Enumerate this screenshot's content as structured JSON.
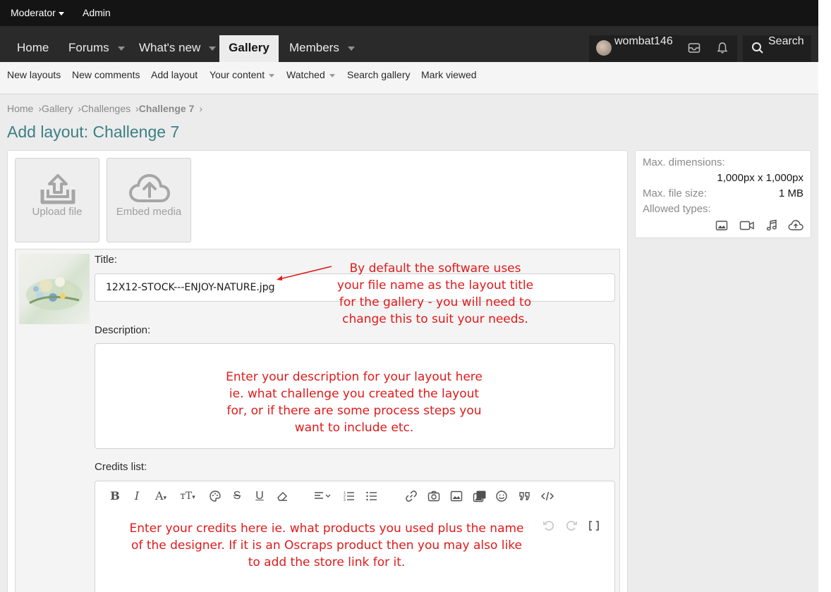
{
  "staffbar": {
    "moderator": "Moderator",
    "admin": "Admin"
  },
  "nav": {
    "tabs": [
      {
        "label": "Home"
      },
      {
        "label": "Forums"
      },
      {
        "label": "What's new"
      },
      {
        "label": "Gallery"
      },
      {
        "label": "Members"
      }
    ],
    "user": "wombat146",
    "search": "Search"
  },
  "subnav": {
    "items": [
      "New layouts",
      "New comments",
      "Add layout",
      "Your content",
      "Watched",
      "Search gallery",
      "Mark viewed"
    ]
  },
  "breadcrumb": [
    "Home",
    "Gallery",
    "Challenges",
    "Challenge 7"
  ],
  "page_title": "Add layout: Challenge 7",
  "upload": {
    "upload_file": "Upload file",
    "embed_media": "Embed media"
  },
  "form": {
    "title_label": "Title:",
    "title_value": "12X12-STOCK---ENJOY-NATURE.jpg",
    "description_label": "Description:",
    "credits_label": "Credits list:"
  },
  "annotations": {
    "title_note": [
      "By default the software uses",
      "your file name as the layout title",
      "for the gallery - you will need to",
      "change this to suit your needs."
    ],
    "description_note": [
      "Enter your description for your layout here",
      "ie. what challenge you created the layout",
      "for, or if there are some process steps you",
      "want to include etc."
    ],
    "credits_note": [
      "Enter your credits here ie. what products you used plus the name",
      "of the designer. If it is an Oscraps product then you may also like",
      "to add the store link for it."
    ]
  },
  "sidebar": {
    "max_dimensions_label": "Max. dimensions:",
    "max_dimensions_value": "1,000px x 1,000px",
    "max_file_size_label": "Max. file size:",
    "max_file_size_value": "1 MB",
    "allowed_types_label": "Allowed types:"
  },
  "colors": {
    "accent": "#3c7f85",
    "annotation": "#e01a1a",
    "header": "#2a2a2a"
  }
}
